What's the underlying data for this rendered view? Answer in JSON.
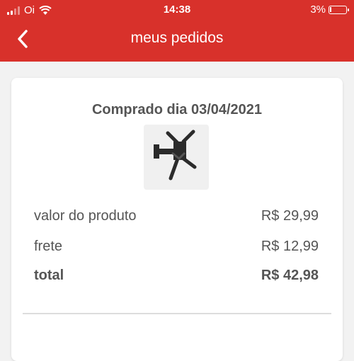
{
  "status_bar": {
    "carrier": "Oi",
    "time": "14:38",
    "battery": "3%"
  },
  "header": {
    "title": "meus pedidos"
  },
  "order": {
    "date_label": "Comprado dia 03/04/2021",
    "product_image_icon": "tv-wall-mount-icon",
    "lines": [
      {
        "label": "valor do produto",
        "value": "R$ 29,99"
      },
      {
        "label": "frete",
        "value": "R$ 12,99"
      },
      {
        "label": "total",
        "value": "R$ 42,98"
      }
    ]
  },
  "colors": {
    "brand": "#d8312b",
    "background": "#f2f2f2",
    "text": "#555555"
  }
}
